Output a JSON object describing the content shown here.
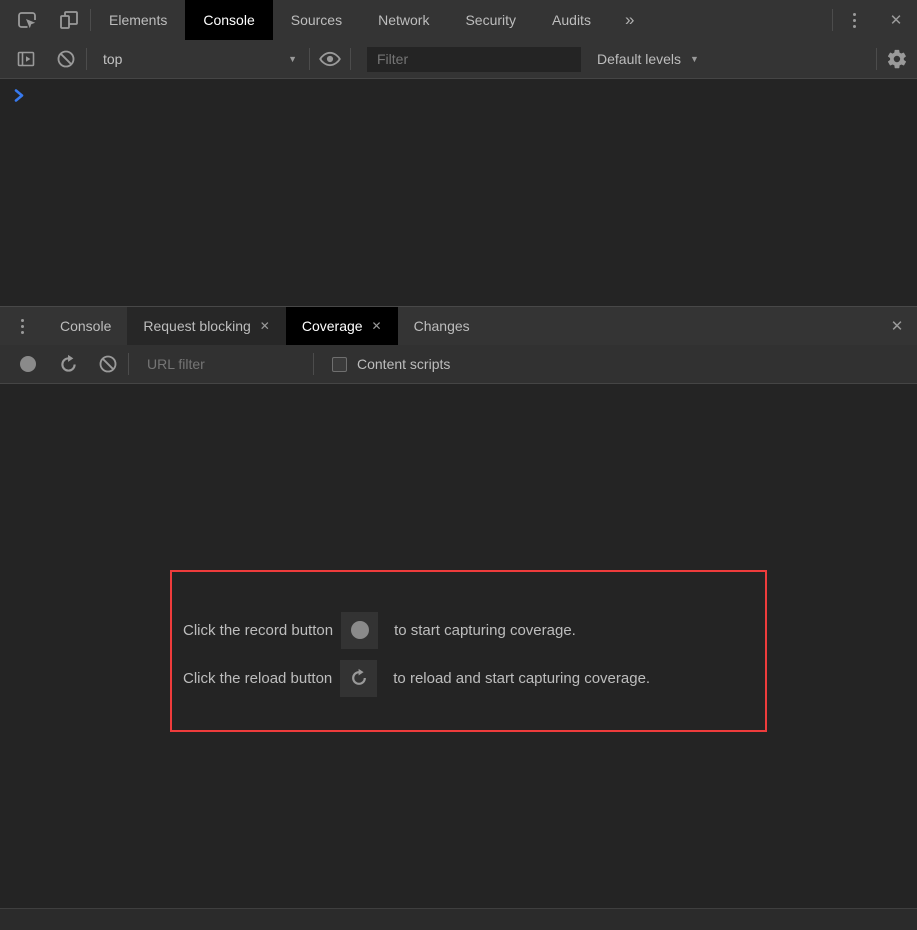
{
  "colors": {
    "accent_blue": "#3779ee",
    "highlight_red": "#ee3c3c",
    "toolbar_bg": "#343434",
    "content_bg": "#242424",
    "active_tab_bg": "#000000",
    "icon_gray": "#9a9a9a"
  },
  "main_tabbar": {
    "tabs": [
      {
        "label": "Elements",
        "active": false
      },
      {
        "label": "Console",
        "active": true
      },
      {
        "label": "Sources",
        "active": false
      },
      {
        "label": "Network",
        "active": false
      },
      {
        "label": "Security",
        "active": false
      },
      {
        "label": "Audits",
        "active": false
      }
    ],
    "more_tabs_glyph": "»",
    "close_glyph": "✕"
  },
  "console_toolbar": {
    "context_value": "top",
    "dropdown_glyph": "▼",
    "filter_placeholder": "Filter",
    "levels_value": "Default levels"
  },
  "drawer": {
    "tabs": [
      {
        "label": "Console",
        "active": false,
        "closable": false
      },
      {
        "label": "Request blocking",
        "active": false,
        "closable": true
      },
      {
        "label": "Coverage",
        "active": true,
        "closable": true
      },
      {
        "label": "Changes",
        "active": false,
        "closable": false
      }
    ],
    "tab_close_glyph": "✕",
    "close_glyph": "✕"
  },
  "coverage_toolbar": {
    "url_filter_placeholder": "URL filter",
    "content_scripts_label": "Content scripts",
    "content_scripts_checked": false
  },
  "coverage_panel": {
    "line1": {
      "before": "Click the record button",
      "after": "to start capturing coverage."
    },
    "line2": {
      "before": "Click the reload button",
      "after": "to reload and start capturing coverage."
    }
  },
  "icon_map": {
    "inspect-icon": "cursor-arrow-over-box",
    "device-toolbar-icon": "phone-and-tablet-outline",
    "kebab-menu-icon": "three-vertical-dots",
    "close-icon": "unicode ✕",
    "more-tabs-icon": "unicode »",
    "console-sidebar-icon": "box-with-play-triangle",
    "clear-console-icon": "circle-with-diagonal-slash",
    "eye-icon": "eye-outline-with-pupil",
    "gear-icon": "settings-gear",
    "prompt-chevron-icon": "blue-right-chevron",
    "record-icon": "filled-gray-circle",
    "reload-icon": "circular-arrow-clockwise",
    "block-icon": "circle-with-diagonal-slash",
    "dropdown-arrow-icon": "unicode ▼"
  }
}
